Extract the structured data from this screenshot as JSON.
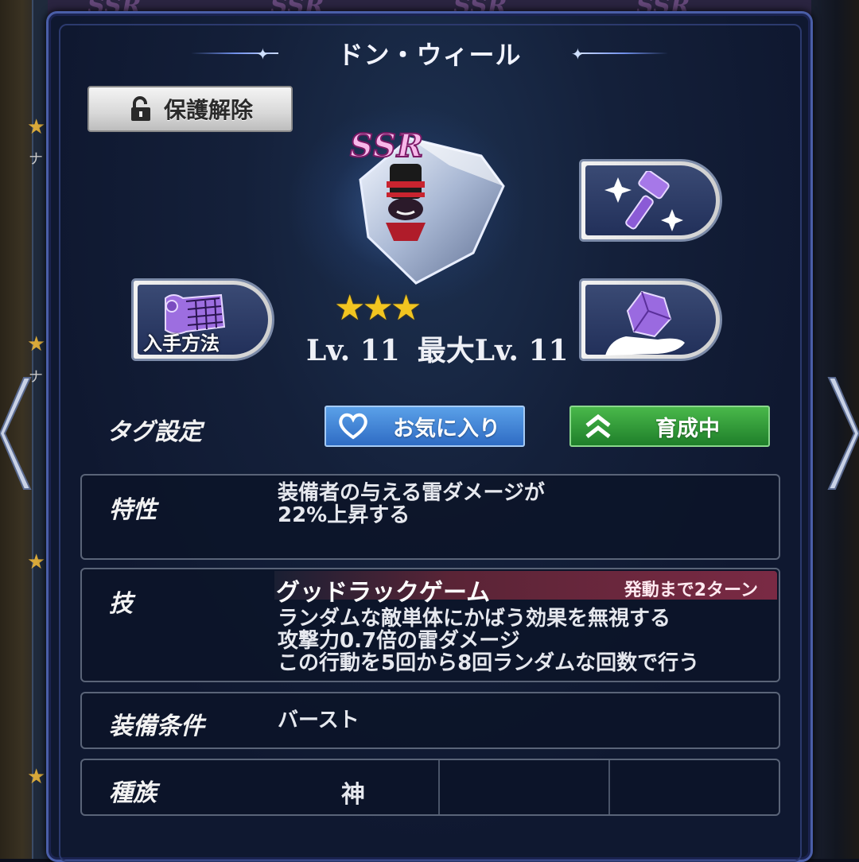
{
  "window": {
    "title": "ドン・ウィール"
  },
  "background": {
    "ssr_label": "SSR",
    "side_label": "ナ"
  },
  "protect_button": {
    "label": "保護解除",
    "icon": "unlock-icon"
  },
  "item": {
    "rarity": "SSR",
    "stars": 3,
    "stars_text": "★★★",
    "level": "Lv. 11",
    "max_level": "最大Lv. 11"
  },
  "acquire_button": {
    "label": "入手方法",
    "icon": "scroll-map-icon"
  },
  "upgrade_button": {
    "icon": "sparkle-hammer-icon"
  },
  "sell_button": {
    "icon": "gem-hand-icon"
  },
  "tags": {
    "label": "タグ設定",
    "favorite": {
      "label": "お気に入り",
      "icon": "heart-icon",
      "color": "#2f6cc4"
    },
    "training": {
      "label": "育成中",
      "icon": "double-chevron-up-icon",
      "color": "#1f7f2a"
    }
  },
  "trait": {
    "label": "特性",
    "lines": [
      "装備者の与える雷ダメージが",
      "22%上昇する"
    ]
  },
  "skill": {
    "label": "技",
    "name": "グッドラックゲーム",
    "cooldown": "発動まで2ターン",
    "lines": [
      "ランダムな敵単体にかばう効果を無視する",
      "攻撃力0.7倍の雷ダメージ",
      "この行動を5回から8回ランダムな回数で行う"
    ]
  },
  "equip_condition": {
    "label": "装備条件",
    "value": "バースト"
  },
  "race": {
    "label": "種族",
    "value": "神"
  },
  "colors": {
    "panel_border": "#4a5ea8",
    "accent_title": "#6f8ee8",
    "skill_bar": "#7a2a44"
  }
}
